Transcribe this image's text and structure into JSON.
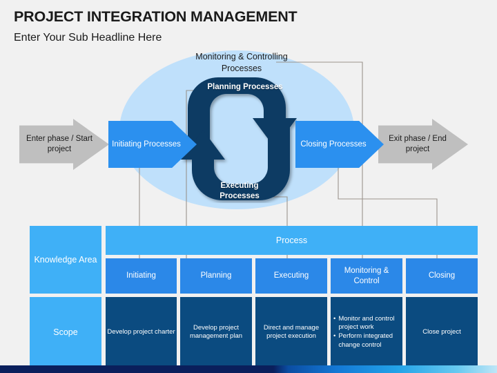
{
  "header": {
    "title": "PROJECT INTEGRATION MANAGEMENT",
    "subtitle": "Enter Your Sub Headline Here"
  },
  "diagram": {
    "enter_phase": "Enter phase / Start project",
    "exit_phase": "Exit phase / End project",
    "initiating": "Initiating Processes",
    "closing": "Closing Processes",
    "planning": "Planning Processes",
    "executing": "Executing Processes",
    "monitoring": "Monitoring & Controlling Processes"
  },
  "table": {
    "row_header_label": "Knowledge Area",
    "process_header": "Process",
    "phases": [
      "Initiating",
      "Planning",
      "Executing",
      "Monitoring & Control",
      "Closing"
    ],
    "rows": [
      {
        "area": "Scope",
        "cells": [
          {
            "text": "Develop project charter"
          },
          {
            "text": "Develop project management plan"
          },
          {
            "text": "Direct and manage project execution"
          },
          {
            "bullets": [
              "Monitor and control project work",
              "Perform integrated change control"
            ]
          },
          {
            "text": "Close project"
          }
        ]
      }
    ]
  },
  "colors": {
    "background": "#f1f1f1",
    "ellipse": "#bfe0fb",
    "blue_arrow": "#2b90ef",
    "gray_arrow": "#bfbfbf",
    "cycle_dark": "#0b3a63",
    "cell_light": "#3fb0f7",
    "cell_mid": "#2b88e8",
    "cell_dark": "#0b4b80",
    "connector": "#9a938c",
    "accent_dark": "#0a1f5c",
    "accent_cyan": "#23a3e8"
  }
}
